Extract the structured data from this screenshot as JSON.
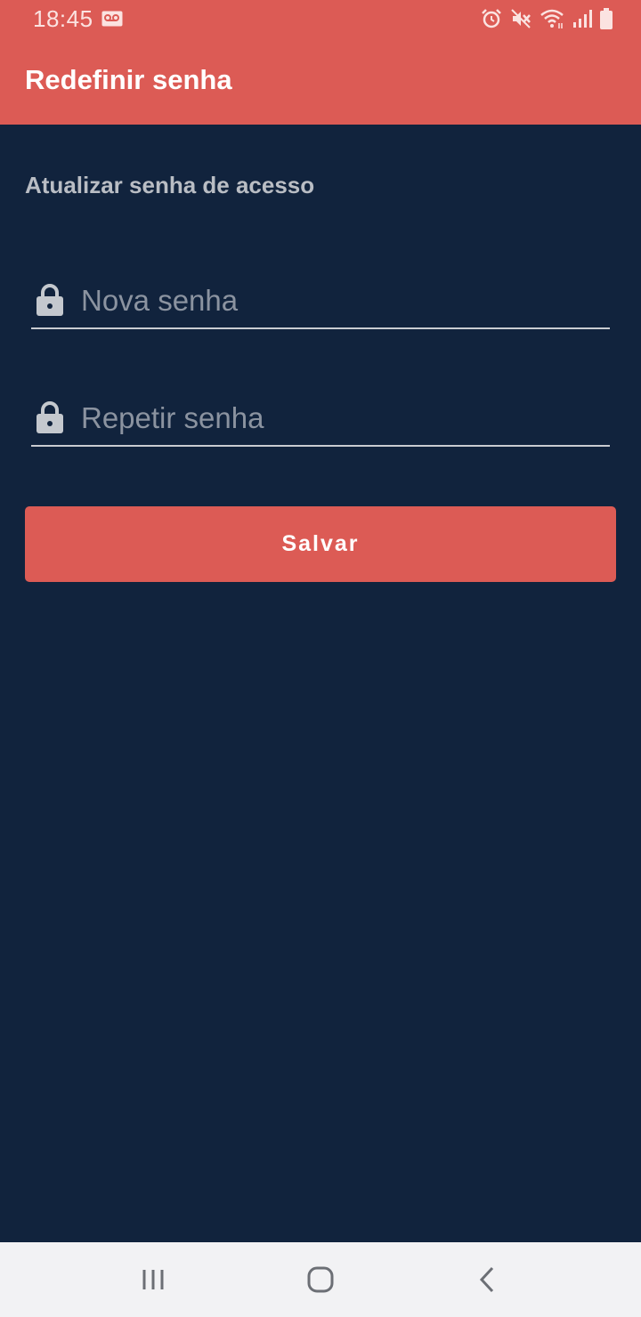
{
  "status_bar": {
    "time": "18:45",
    "icons": [
      "voicemail-icon",
      "alarm-icon",
      "mute-icon",
      "wifi-icon",
      "signal-icon",
      "battery-icon"
    ]
  },
  "app_bar": {
    "title": "Redefinir senha"
  },
  "form": {
    "heading": "Atualizar senha de acesso",
    "new_password": {
      "placeholder": "Nova senha",
      "value": "",
      "icon": "lock-icon"
    },
    "repeat_password": {
      "placeholder": "Repetir senha",
      "value": "",
      "icon": "lock-icon"
    },
    "save_label": "Salvar"
  },
  "nav_bar": {
    "buttons": [
      "recent-apps-icon",
      "home-icon",
      "back-icon"
    ]
  },
  "colors": {
    "accent": "#dc5b55",
    "background": "#11233d",
    "heading_text": "#b9bdc4",
    "placeholder_text": "#8b93a0",
    "nav_bar": "#f2f2f4"
  }
}
